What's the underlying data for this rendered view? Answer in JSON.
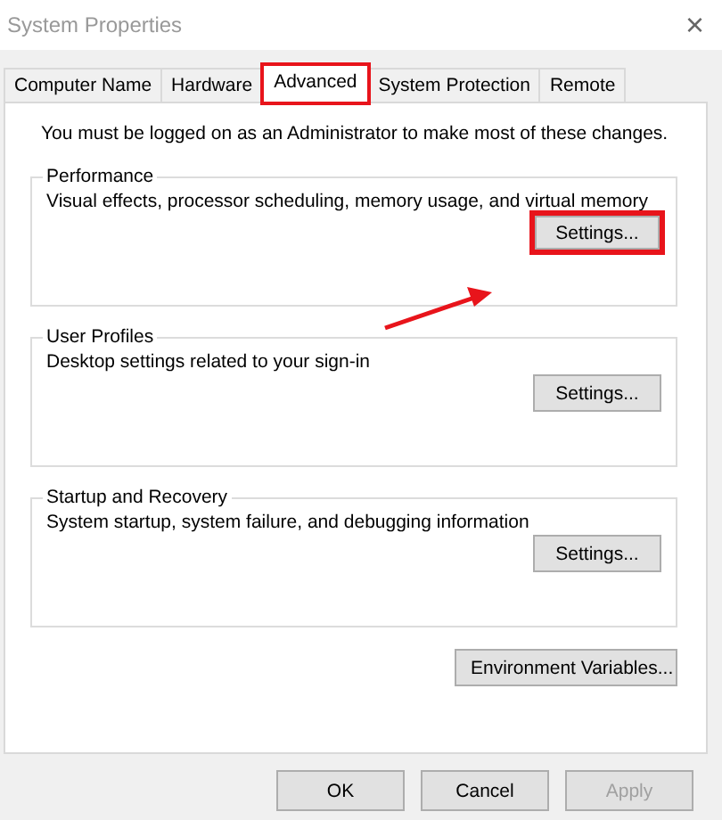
{
  "window": {
    "title": "System Properties",
    "close": "×"
  },
  "tabs": [
    {
      "label": "Computer Name",
      "selected": false,
      "highlighted": false
    },
    {
      "label": "Hardware",
      "selected": false,
      "highlighted": false
    },
    {
      "label": "Advanced",
      "selected": true,
      "highlighted": true
    },
    {
      "label": "System Protection",
      "selected": false,
      "highlighted": false
    },
    {
      "label": "Remote",
      "selected": false,
      "highlighted": false
    }
  ],
  "notice": "You must be logged on as an Administrator to make most of these changes.",
  "groups": [
    {
      "title": "Performance",
      "description": "Visual effects, processor scheduling, memory usage, and virtual memory",
      "button": {
        "label": "Settings...",
        "highlighted": true
      }
    },
    {
      "title": "User Profiles",
      "description": "Desktop settings related to your sign-in",
      "button": {
        "label": "Settings...",
        "highlighted": false
      }
    },
    {
      "title": "Startup and Recovery",
      "description": "System startup, system failure, and debugging information",
      "button": {
        "label": "Settings...",
        "highlighted": false
      }
    }
  ],
  "environment_button": "Environment Variables...",
  "annotation": {
    "kind": "arrow"
  },
  "buttons": [
    {
      "label": "OK",
      "disabled": false
    },
    {
      "label": "Cancel",
      "disabled": false
    },
    {
      "label": "Apply",
      "disabled": true
    }
  ]
}
